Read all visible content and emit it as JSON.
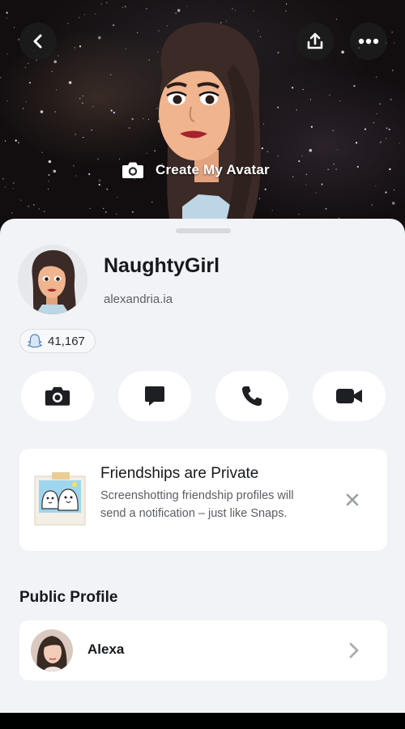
{
  "header": {
    "create_avatar_label": "Create My Avatar",
    "icons": [
      "back-icon",
      "share-icon",
      "more-icon",
      "camera-icon"
    ]
  },
  "profile": {
    "display_name": "NaughtyGirl",
    "username": "alexandria.ia",
    "snap_score": "41,167"
  },
  "actions": [
    {
      "icon": "camera-icon"
    },
    {
      "icon": "chat-icon"
    },
    {
      "icon": "phone-icon"
    },
    {
      "icon": "video-icon"
    }
  ],
  "privacy_card": {
    "title": "Friendships are Private",
    "body": "Screenshotting friendship profiles will send a notification – just like Snaps."
  },
  "public_profile": {
    "heading": "Public Profile",
    "name": "Alexa"
  },
  "colors": {
    "sheet_bg": "#f2f3f6",
    "card_bg": "#ffffff",
    "text_primary": "#16191c",
    "text_secondary": "#5d6066"
  }
}
